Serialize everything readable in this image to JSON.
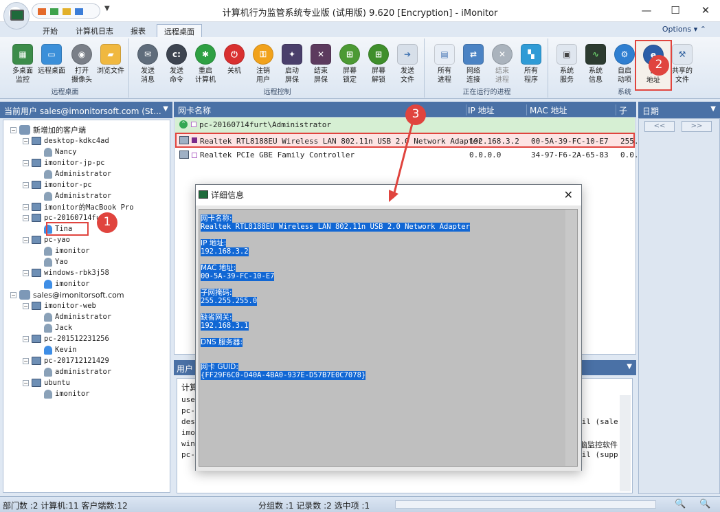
{
  "window": {
    "title": "计算机行为监管系统专业版 (试用版) 9.620 [Encryption] - iMonitor",
    "min": "—",
    "max": "☐",
    "close": "✕"
  },
  "tabs": [
    {
      "label": "开始"
    },
    {
      "label": "计算机日志"
    },
    {
      "label": "报表"
    },
    {
      "label": "远程桌面"
    }
  ],
  "options_label": "Options",
  "ribbon": {
    "groups": [
      {
        "label": "远程桌面",
        "buttons": [
          "多桌面\n监控",
          "远程桌面",
          "打开\n摄像头",
          "浏览文件"
        ]
      },
      {
        "label": "远程控制",
        "buttons": [
          "发送\n消息",
          "发送\n命令",
          "重启\n计算机",
          "关机",
          "注销\n用户",
          "启动\n屏保",
          "结束\n屏保",
          "屏幕\n锁定",
          "屏幕\n解锁",
          "发送\n文件"
        ]
      },
      {
        "label": "正在运行的进程",
        "buttons": [
          "所有\n进程",
          "网络\n连接",
          "结束\n进程",
          "所有\n程序"
        ]
      },
      {
        "label": "系统",
        "buttons": [
          "系统\n服务",
          "系统\n信息",
          "自启\n动项",
          "IP\n地址",
          "共享的\n文件"
        ]
      }
    ]
  },
  "left": {
    "header": "当前用户 sales@imonitorsoft.com (St...",
    "tree": [
      {
        "label": "新增加的客户端",
        "kind": "group"
      },
      {
        "label": "desktop-kdkc4ad",
        "kind": "pc"
      },
      {
        "label": "Nancy",
        "kind": "user"
      },
      {
        "label": "imonitor-jp-pc",
        "kind": "pc"
      },
      {
        "label": "Administrator",
        "kind": "user"
      },
      {
        "label": "imonitor-pc",
        "kind": "pc"
      },
      {
        "label": "Administrator",
        "kind": "user"
      },
      {
        "label": "imonitor的MacBook Pro",
        "kind": "pc"
      },
      {
        "label": "pc-20160714furt",
        "kind": "pc"
      },
      {
        "label": "Tina",
        "kind": "user-on"
      },
      {
        "label": "pc-yao",
        "kind": "pc"
      },
      {
        "label": "imonitor",
        "kind": "user"
      },
      {
        "label": "Yao",
        "kind": "user"
      },
      {
        "label": "windows-rbk3j58",
        "kind": "pc"
      },
      {
        "label": "imonitor",
        "kind": "user-on"
      },
      {
        "label": "sales@imonitorsoft.com",
        "kind": "group"
      },
      {
        "label": "imonitor-web",
        "kind": "pc"
      },
      {
        "label": "Administrator",
        "kind": "user"
      },
      {
        "label": "Jack",
        "kind": "user"
      },
      {
        "label": "pc-201512231256",
        "kind": "pc"
      },
      {
        "label": "Kevin",
        "kind": "user-on"
      },
      {
        "label": "pc-201712121429",
        "kind": "pc"
      },
      {
        "label": "administrator",
        "kind": "user"
      },
      {
        "label": "ubuntu",
        "kind": "pc"
      },
      {
        "label": "imonitor",
        "kind": "user"
      }
    ]
  },
  "table": {
    "columns": [
      "网卡名称",
      "IP 地址",
      "MAC 地址",
      "子网"
    ],
    "group_row": "pc-20160714furt\\Administrator",
    "rows": [
      {
        "name": "Realtek RTL8188EU Wireless LAN 802.11n USB 2.0 Network Adapter",
        "ip": "192.168.3.2",
        "mac": "00-5A-39-FC-10-E7",
        "mask": "255."
      },
      {
        "name": "Realtek PCIe GBE Family Controller",
        "ip": "0.0.0.0",
        "mac": "34-97-F6-2A-65-83",
        "mask": "0.0."
      }
    ]
  },
  "bottom": {
    "header": "用户",
    "lines": [
      "计算",
      "use",
      "pc-",
      "des",
      "imo",
      "win",
      "pc-",
      "ail (sale",
      "脑监控软件",
      "ail (supp"
    ]
  },
  "right": {
    "header": "日期",
    "prev": "<<",
    "next": ">>"
  },
  "dialog": {
    "title": "详细信息",
    "lines": [
      "网卡名称:",
      "Realtek RTL8188EU Wireless LAN 802.11n USB 2.0 Network Adapter",
      "IP 地址:",
      "192.168.3.2",
      "MAC 地址:",
      "00-5A-39-FC-10-E7",
      "子网掩码:",
      "255.255.255.0",
      "缺省网关:",
      "192.168.3.1",
      "DNS 服务器:",
      "网卡 GUID:",
      "{FF29F6C0-D40A-4BA0-937E-D57B7E0C7078}"
    ]
  },
  "badges": [
    "1",
    "2",
    "3"
  ],
  "status": {
    "left": "部门数 :2  计算机:11  客户端数:12",
    "right": "分组数 :1  记录数 :2  选中项 :1"
  }
}
